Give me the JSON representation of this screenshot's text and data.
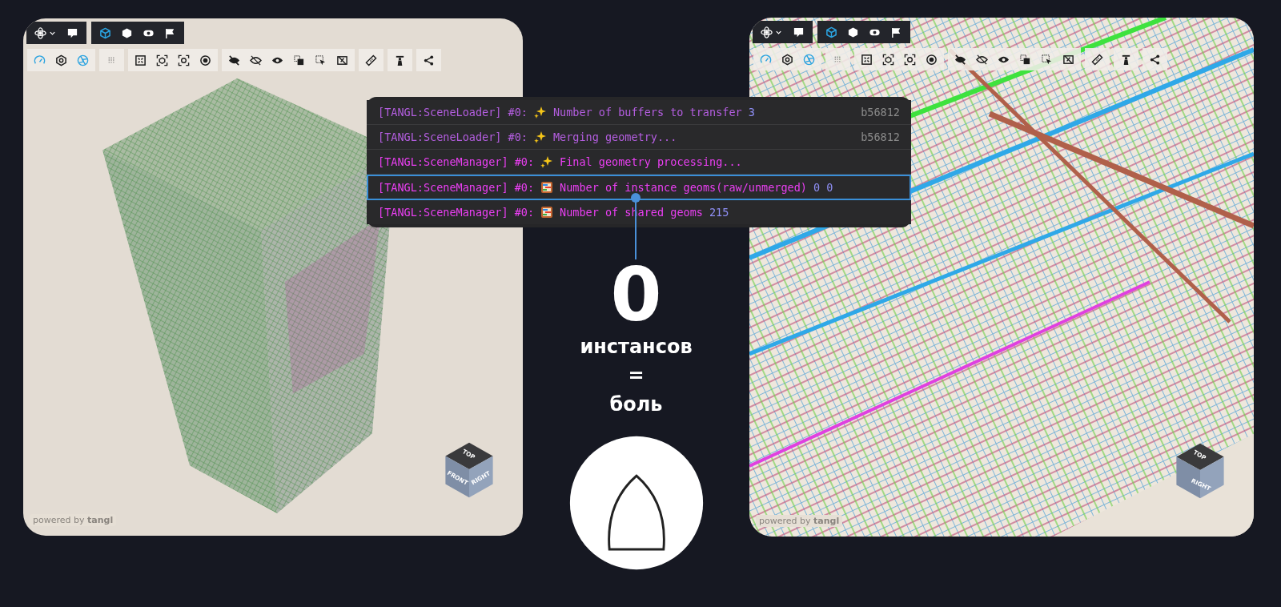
{
  "viewers": [
    {
      "top_toolbar": [
        {
          "buttons": [
            {
              "active": false
            },
            {
              "active": false
            }
          ]
        },
        {
          "buttons": [
            {
              "active": true
            },
            {
              "active": false
            },
            {
              "active": false
            },
            {
              "active": false
            }
          ]
        }
      ],
      "toolbar": [
        {
          "buttons": [
            {
              "active": true
            },
            {
              "active": false
            },
            {
              "active": true
            }
          ]
        },
        {
          "buttons": [
            {
              "active": false
            }
          ]
        },
        {
          "buttons": [
            {
              "active": false
            },
            {
              "active": false
            },
            {
              "active": false
            },
            {
              "active": false
            }
          ]
        },
        {
          "buttons": [
            {
              "active": false
            },
            {
              "active": false
            },
            {
              "active": false
            },
            {
              "active": false
            },
            {
              "active": false
            },
            {
              "active": false
            }
          ]
        },
        {
          "buttons": [
            {
              "active": false
            }
          ]
        },
        {
          "buttons": [
            {
              "active": false
            }
          ]
        },
        {
          "buttons": [
            {
              "active": false
            }
          ]
        }
      ],
      "scene": {
        "kind": "tower"
      },
      "cube_faces": [
        {
          "kind": "top",
          "label": "TOP"
        },
        {
          "kind": "front",
          "label": "FRONT"
        },
        {
          "kind": "right",
          "label": "RIGHT"
        }
      ],
      "powered_by": "powered by **tangl**"
    },
    {
      "top_toolbar": [
        {
          "buttons": [
            {
              "active": false
            },
            {
              "active": false
            }
          ]
        },
        {
          "buttons": [
            {
              "active": true
            },
            {
              "active": false
            },
            {
              "active": false
            },
            {
              "active": false
            }
          ]
        }
      ],
      "toolbar": [
        {
          "buttons": [
            {
              "active": true
            },
            {
              "active": false
            },
            {
              "active": true
            }
          ]
        },
        {
          "buttons": [
            {
              "active": false
            }
          ]
        },
        {
          "buttons": [
            {
              "active": false
            },
            {
              "active": false
            },
            {
              "active": false
            },
            {
              "active": false
            }
          ]
        },
        {
          "buttons": [
            {
              "active": false
            },
            {
              "active": false
            },
            {
              "active": false
            },
            {
              "active": false
            },
            {
              "active": false
            },
            {
              "active": false
            }
          ]
        },
        {
          "buttons": [
            {
              "active": false
            }
          ]
        },
        {
          "buttons": [
            {
              "active": false
            }
          ]
        },
        {
          "buttons": [
            {
              "active": false
            }
          ]
        }
      ],
      "scene": {
        "kind": "grid"
      },
      "cube_faces": [
        {
          "kind": "top",
          "label": "TOP"
        },
        {
          "kind": "bottom",
          "label": "RIGHT"
        }
      ],
      "powered_by": "powered by **tangl**"
    }
  ],
  "console": [
    {
      "source": "[TANGL:SceneLoader] #0:",
      "kind": "sparkles",
      "message": "Number of buffers to transfer",
      "value": "3",
      "file": "b56812",
      "color": "#b45ee0",
      "highlighted": false
    },
    {
      "source": "[TANGL:SceneLoader] #0:",
      "kind": "sparkles",
      "message": "Merging geometry...",
      "file": "b56812",
      "color": "#b45ee0",
      "highlighted": false
    },
    {
      "source": "[TANGL:SceneManager] #0:",
      "kind": "sparkles",
      "message": "Final geometry processing...",
      "color": "#ea3ff2",
      "highlighted": false
    },
    {
      "source": "[TANGL:SceneManager] #0:",
      "kind": "abacus",
      "message": "Number of instance geoms(raw/unmerged)",
      "value": "0 0",
      "color": "#ea3ff2",
      "highlighted": true
    },
    {
      "source": "[TANGL:SceneManager] #0:",
      "kind": "abacus",
      "message": "Number of shared geoms",
      "value": "215",
      "color": "#ea3ff2",
      "highlighted": false
    }
  ],
  "headline": {
    "value": "0",
    "caption": "инстансов",
    "equals": "=",
    "result": "боль"
  }
}
